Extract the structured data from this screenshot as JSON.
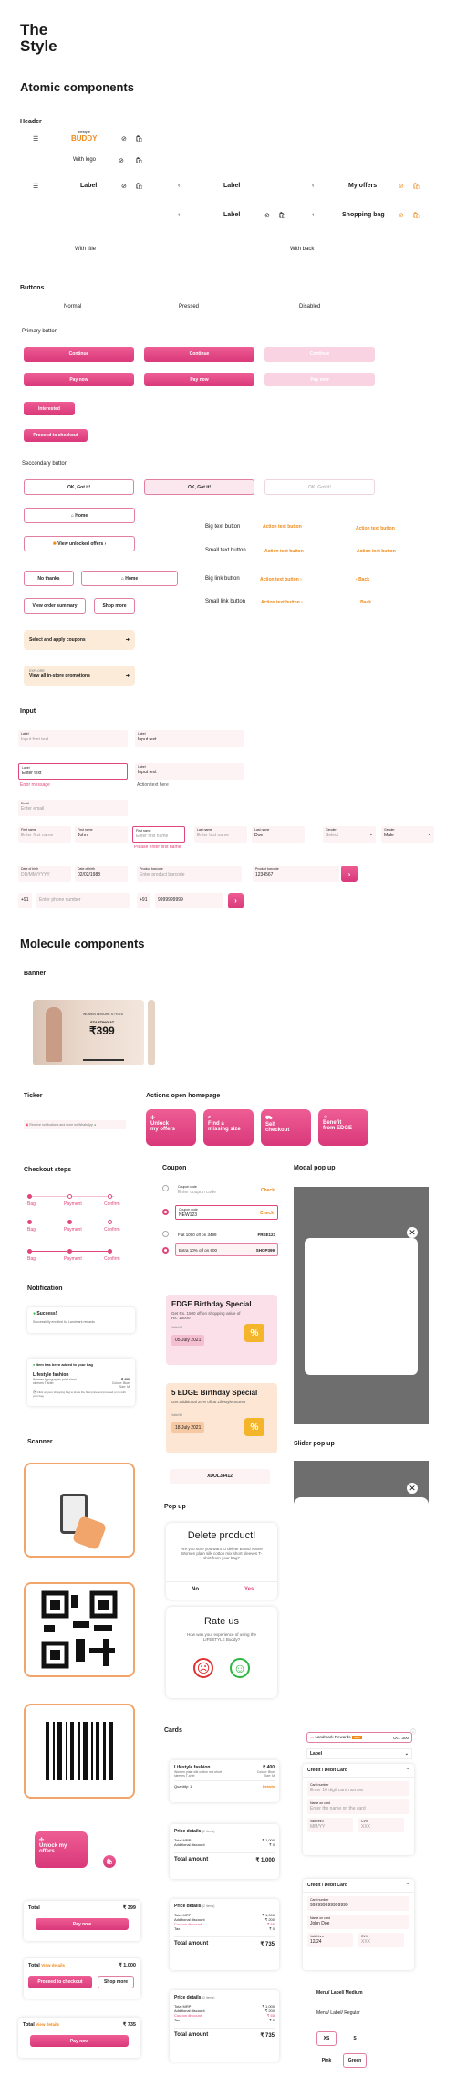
{
  "title": {
    "line1": "The",
    "line2": "Style"
  },
  "sections": {
    "atomic": "Atomic components",
    "header": "Header",
    "buttons": "Buttons",
    "input": "Input",
    "molecule": "Molecule components",
    "banner": "Banner",
    "ticker": "Ticker",
    "actions": "Actions open homepage",
    "checkout": "Checkout steps",
    "coupon": "Coupon",
    "modal": "Modal pop up",
    "notification": "Notification",
    "scanner": "Scanner",
    "popup": "Pop up",
    "slider": "Slider pop up",
    "cards": "Cards"
  },
  "header": {
    "logo_top": "lifestyle",
    "logo_main": "BUDDY",
    "with_logo": "With logo",
    "label": "Label",
    "my_offers": "My offers",
    "shopping_bag": "Shopping bag",
    "with_title": "With title",
    "with_back": "With back"
  },
  "buttons": {
    "normal": "Normal",
    "pressed": "Pressed",
    "disabled": "Disabled",
    "primary": "Primary button",
    "continue": "Continue",
    "pay_now": "Pay now",
    "interested": "Interested",
    "proceed": "Proceed to checkout",
    "secondary": "Seccondary button",
    "ok": "OK, Got it!",
    "home": "Home",
    "view_unlocked": "View unlocked offers",
    "no_thanks": "No thanks",
    "view_order": "View order summary",
    "shop_more": "Shop more",
    "apply_coupons": "Select and apply coupons",
    "explore": "EXPLORE",
    "view_promotions": "View all in-store promotions",
    "big_text": "Big text button",
    "small_text": "Small text button",
    "big_link": "Big link button",
    "small_link": "Small link button",
    "action_text": "Action text button",
    "back": "Back"
  },
  "input": {
    "label": "Label",
    "placeholder": "Input font text",
    "input_text": "Input text",
    "enter_text": "Enter text",
    "error": "Error message",
    "action_text": "Action text here",
    "email": "Email",
    "enter_email": "Enter email",
    "first_name": "First name",
    "enter_first": "Enter first name",
    "john": "John",
    "please_first": "Please enter first name",
    "last_name": "Last name",
    "enter_last": "Enter last name",
    "doe": "Doe",
    "gender": "Gender",
    "select": "Select",
    "male": "Male",
    "dob": "Date of birth",
    "dob_ph": "DD/MM/YYYY",
    "dob_val": "02/02/1988",
    "barcode": "Product barcode",
    "barcode_ph": "Enter product barcode",
    "barcode_val": "1234567",
    "code": "+91",
    "phone_ph": "Enter phone number",
    "phone_val": "9999999999"
  },
  "banner": {
    "tag": "WOMEN LEISURE STYLES",
    "starting": "STARTING AT",
    "price": "₹399"
  },
  "ticker": {
    "text": "Receive notifications and more on WhatsApp"
  },
  "actions": [
    {
      "l1": "Unlock",
      "l2": "my offers"
    },
    {
      "l1": "Find a",
      "l2": "missing size"
    },
    {
      "l1": "Self",
      "l2": "checkout"
    },
    {
      "l1": "Benefit",
      "l2": "from EDGE"
    }
  ],
  "checkout": {
    "bag": "Bag",
    "payment": "Payment",
    "confirm": "Confirm"
  },
  "coupon": {
    "code": "Coupon code",
    "enter_code": "Enter coupon code",
    "check": "Check",
    "newcode": "NEW123",
    "flat": "Flat 1000 off on 3499",
    "flat_code": "FREE123",
    "extra": "Extra 10% off on 600",
    "extra_code": "SHOP399",
    "birthday_title": "EDGE Birthday Special",
    "birthday_desc": "Get Rs. 1500 off on shopping value of Rs. 15000",
    "valid_till": "Valid till",
    "date1": "05 July 2021",
    "edge5": "5 EDGE Birthday Special",
    "edge5_desc": "Get additional 20% off at Lifestyle Stores",
    "date2": "18 July 2021",
    "discount": "%",
    "coupon_code_small": "XDOL34412"
  },
  "notification": {
    "success": "Success!",
    "success_desc": "Successfully enrolled for Landmark rewards",
    "added": "Item has been added to your bag",
    "item": "Lifestyle fashion",
    "item_desc": "Women typographic print short sleeves T-shirt",
    "price": "₹ 400",
    "colour": "Colour: Blue",
    "size": "Size: M",
    "bag_note": "Click on your shopping bag to know the final price and proceed on to with your bag"
  },
  "popup": {
    "delete_title": "Delete product!",
    "delete_desc": "Are you sure you want to delete Brand Name Women plain silk cotton mix short sleeves T-shirt from your bag?",
    "no": "No",
    "yes": "Yes",
    "rate_title": "Rate us",
    "rate_desc": "How was your experience of using the LIFESTYLE Buddy?"
  },
  "cards": {
    "lf": "Lifestyle fashion",
    "lf_desc": "Women plain silk cotton mix short sleeves T-shirt",
    "price400": "₹ 400",
    "colour": "Colour: Blue",
    "size": "Size: M",
    "qty": "Quantity: 1",
    "details": "Details",
    "price_details": "Price details",
    "items": "(2 items)",
    "total_mrp": "Total MRP",
    "mrp_val": "₹ 1,000",
    "addl": "Additional discount",
    "addl_val": "₹ 0",
    "coupon_disc": "Coupon discount",
    "coupon_val": "₹ 0",
    "tax": "Tax",
    "tax_val": "₹ 0",
    "total_amount": "Total amount",
    "total1000": "₹ 1,000",
    "total735": "₹ 735",
    "addl2": "₹ 200",
    "coupon2": "₹ 65",
    "unlock": "Unlock my offers",
    "total": "Total",
    "t399": "₹ 399",
    "view_details": "View details",
    "t1000": "₹ 1,000",
    "t735": "₹ 735",
    "pay_now": "Pay now",
    "proceed": "Proceed to checkout",
    "shop_more": "Shop more",
    "landmark": "Landmark Rewards",
    "oct": "Oct. 300",
    "label": "Label",
    "dcard": "Credit / Debit Card",
    "card_number": "Card number",
    "card_ph": "Enter 16 digit card number",
    "name_on_card": "Name on card",
    "name_ph": "Enter the name on the card",
    "valid_thru": "Valid thru",
    "mmyy": "MM/YY",
    "cvv": "CVV",
    "cvv_ph": "XXX",
    "card_val": "999999999999999",
    "name_val": "John Doe",
    "valid_val": "12/24",
    "menu": "Menu/ Label/ Medium",
    "menu_reg": "Menu/ Label/ Regular",
    "xs": "XS",
    "s": "S",
    "pink": "Pink",
    "green": "Green"
  },
  "colors": {
    "primary": "#e0457b",
    "accent": "#f08a1c",
    "soft": "#fdf3f5"
  }
}
